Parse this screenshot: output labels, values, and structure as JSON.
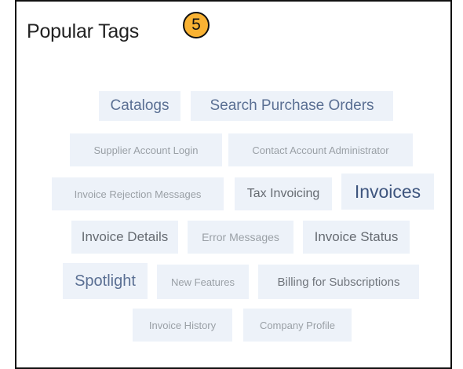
{
  "header": {
    "title": "Popular Tags",
    "badge": "5"
  },
  "tags": [
    {
      "label": "Catalogs"
    },
    {
      "label": "Search Purchase Orders"
    },
    {
      "label": "Supplier Account Login"
    },
    {
      "label": "Contact Account Administrator"
    },
    {
      "label": "Invoice Rejection Messages"
    },
    {
      "label": "Tax Invoicing"
    },
    {
      "label": "Invoices"
    },
    {
      "label": "Invoice Details"
    },
    {
      "label": "Error Messages"
    },
    {
      "label": "Invoice Status"
    },
    {
      "label": "Spotlight"
    },
    {
      "label": "New Features"
    },
    {
      "label": "Billing for Subscriptions"
    },
    {
      "label": "Invoice History"
    },
    {
      "label": "Company Profile"
    }
  ],
  "colors": {
    "tag_background": "#edf2f9",
    "badge": "#f9b233",
    "tag_large": "#5a6f93",
    "tag_small": "#9aa0a6"
  }
}
